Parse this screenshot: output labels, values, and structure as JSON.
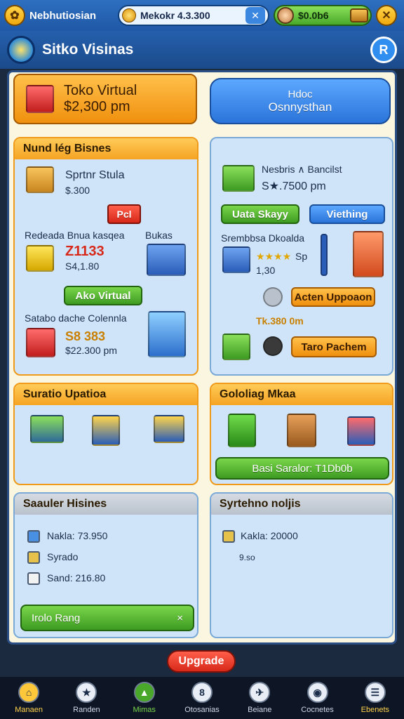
{
  "topbar": {
    "title": "Nebhutiosian",
    "search_value": "Mekokr 4.3.300",
    "money_value": "$0.0b6"
  },
  "header": {
    "title": "Sitko Visinas"
  },
  "promo": {
    "title": "Toko Virtual",
    "amount": "$2,300 pm",
    "blue_button_line1": "Hdoc",
    "blue_button_line2": "Osnnysthan"
  },
  "left_panel": {
    "title": "Nund lég Bisnes",
    "item1_name": "Sprtnr Stula",
    "item1_price": "$.300",
    "tag_label": "Pcl",
    "item2_title": "Redeada Bnua kasqea",
    "item2_side": "Bukas",
    "item2_value": "Z1133",
    "item2_price": "S4,1.80",
    "ako_button": "Ako Virtual",
    "item3_title": "Satabo dache Colennla",
    "item3_value": "S8 383",
    "item3_price": "$22.300 pm"
  },
  "right_panel": {
    "item1_name": "Nesbris ∧ Bancilst",
    "item1_price": "S★.7500 pm",
    "green_button": "Uata Skayy",
    "blue_button": "Viething",
    "item2_title": "Srembbsa Dkoalda",
    "item2_rating": "Sp",
    "item2_price": "1,30",
    "action_button": "Acten Uppoaon",
    "item3_price": "Tk.380 0m",
    "tero_button": "Taro Pachem"
  },
  "upgrades_panel": {
    "title": "Suratio Upatioa"
  },
  "selling_panel": {
    "title": "Gololiag Mkaa",
    "button": "Basi Saralor: T1Db0b"
  },
  "history_panel": {
    "title": "Saauler Hisines",
    "row1": "Nakla: 73.950",
    "row2": "Syrado",
    "row3": "Sand: 216.80",
    "bar_label": "Irolo Rang",
    "bar_close": "×"
  },
  "system_panel": {
    "title": "Syrtehno noljis",
    "row1": "Kakla: 20000",
    "row2": "9.so"
  },
  "upgrade_button": "Upgrade",
  "nav": [
    {
      "label": "Manaen",
      "icon": "house-icon"
    },
    {
      "label": "Randen",
      "icon": "star-icon"
    },
    {
      "label": "Mimas",
      "icon": "chart-icon"
    },
    {
      "label": "Otosanias",
      "icon": "eight-icon"
    },
    {
      "label": "Beiane",
      "icon": "plane-icon"
    },
    {
      "label": "Cocnetes",
      "icon": "camera-icon"
    },
    {
      "label": "Ebenets",
      "icon": "list-icon"
    }
  ]
}
